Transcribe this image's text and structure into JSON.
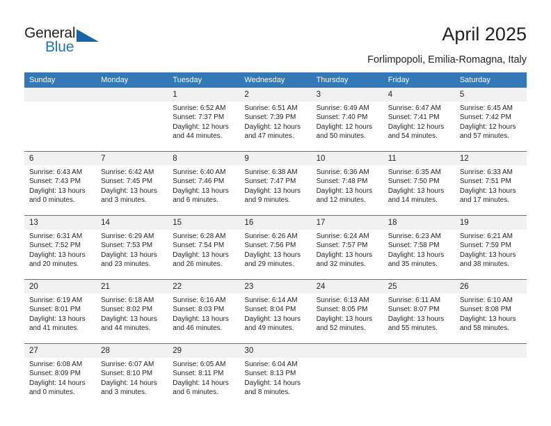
{
  "brand": {
    "name_part1": "General",
    "name_part2": "Blue",
    "accent_color": "#1b76bf"
  },
  "header": {
    "title": "April 2025",
    "subtitle": "Forlimpopoli, Emilia-Romagna, Italy"
  },
  "calendar": {
    "header_bg": "#3479b7",
    "daynum_bg": "#f1f1f1",
    "weekday_headers": [
      "Sunday",
      "Monday",
      "Tuesday",
      "Wednesday",
      "Thursday",
      "Friday",
      "Saturday"
    ],
    "weeks": [
      [
        {
          "day": "",
          "lines": []
        },
        {
          "day": "",
          "lines": []
        },
        {
          "day": "1",
          "lines": [
            "Sunrise: 6:52 AM",
            "Sunset: 7:37 PM",
            "Daylight: 12 hours",
            "and 44 minutes."
          ]
        },
        {
          "day": "2",
          "lines": [
            "Sunrise: 6:51 AM",
            "Sunset: 7:39 PM",
            "Daylight: 12 hours",
            "and 47 minutes."
          ]
        },
        {
          "day": "3",
          "lines": [
            "Sunrise: 6:49 AM",
            "Sunset: 7:40 PM",
            "Daylight: 12 hours",
            "and 50 minutes."
          ]
        },
        {
          "day": "4",
          "lines": [
            "Sunrise: 6:47 AM",
            "Sunset: 7:41 PM",
            "Daylight: 12 hours",
            "and 54 minutes."
          ]
        },
        {
          "day": "5",
          "lines": [
            "Sunrise: 6:45 AM",
            "Sunset: 7:42 PM",
            "Daylight: 12 hours",
            "and 57 minutes."
          ]
        }
      ],
      [
        {
          "day": "6",
          "lines": [
            "Sunrise: 6:43 AM",
            "Sunset: 7:43 PM",
            "Daylight: 13 hours",
            "and 0 minutes."
          ]
        },
        {
          "day": "7",
          "lines": [
            "Sunrise: 6:42 AM",
            "Sunset: 7:45 PM",
            "Daylight: 13 hours",
            "and 3 minutes."
          ]
        },
        {
          "day": "8",
          "lines": [
            "Sunrise: 6:40 AM",
            "Sunset: 7:46 PM",
            "Daylight: 13 hours",
            "and 6 minutes."
          ]
        },
        {
          "day": "9",
          "lines": [
            "Sunrise: 6:38 AM",
            "Sunset: 7:47 PM",
            "Daylight: 13 hours",
            "and 9 minutes."
          ]
        },
        {
          "day": "10",
          "lines": [
            "Sunrise: 6:36 AM",
            "Sunset: 7:48 PM",
            "Daylight: 13 hours",
            "and 12 minutes."
          ]
        },
        {
          "day": "11",
          "lines": [
            "Sunrise: 6:35 AM",
            "Sunset: 7:50 PM",
            "Daylight: 13 hours",
            "and 14 minutes."
          ]
        },
        {
          "day": "12",
          "lines": [
            "Sunrise: 6:33 AM",
            "Sunset: 7:51 PM",
            "Daylight: 13 hours",
            "and 17 minutes."
          ]
        }
      ],
      [
        {
          "day": "13",
          "lines": [
            "Sunrise: 6:31 AM",
            "Sunset: 7:52 PM",
            "Daylight: 13 hours",
            "and 20 minutes."
          ]
        },
        {
          "day": "14",
          "lines": [
            "Sunrise: 6:29 AM",
            "Sunset: 7:53 PM",
            "Daylight: 13 hours",
            "and 23 minutes."
          ]
        },
        {
          "day": "15",
          "lines": [
            "Sunrise: 6:28 AM",
            "Sunset: 7:54 PM",
            "Daylight: 13 hours",
            "and 26 minutes."
          ]
        },
        {
          "day": "16",
          "lines": [
            "Sunrise: 6:26 AM",
            "Sunset: 7:56 PM",
            "Daylight: 13 hours",
            "and 29 minutes."
          ]
        },
        {
          "day": "17",
          "lines": [
            "Sunrise: 6:24 AM",
            "Sunset: 7:57 PM",
            "Daylight: 13 hours",
            "and 32 minutes."
          ]
        },
        {
          "day": "18",
          "lines": [
            "Sunrise: 6:23 AM",
            "Sunset: 7:58 PM",
            "Daylight: 13 hours",
            "and 35 minutes."
          ]
        },
        {
          "day": "19",
          "lines": [
            "Sunrise: 6:21 AM",
            "Sunset: 7:59 PM",
            "Daylight: 13 hours",
            "and 38 minutes."
          ]
        }
      ],
      [
        {
          "day": "20",
          "lines": [
            "Sunrise: 6:19 AM",
            "Sunset: 8:01 PM",
            "Daylight: 13 hours",
            "and 41 minutes."
          ]
        },
        {
          "day": "21",
          "lines": [
            "Sunrise: 6:18 AM",
            "Sunset: 8:02 PM",
            "Daylight: 13 hours",
            "and 44 minutes."
          ]
        },
        {
          "day": "22",
          "lines": [
            "Sunrise: 6:16 AM",
            "Sunset: 8:03 PM",
            "Daylight: 13 hours",
            "and 46 minutes."
          ]
        },
        {
          "day": "23",
          "lines": [
            "Sunrise: 6:14 AM",
            "Sunset: 8:04 PM",
            "Daylight: 13 hours",
            "and 49 minutes."
          ]
        },
        {
          "day": "24",
          "lines": [
            "Sunrise: 6:13 AM",
            "Sunset: 8:05 PM",
            "Daylight: 13 hours",
            "and 52 minutes."
          ]
        },
        {
          "day": "25",
          "lines": [
            "Sunrise: 6:11 AM",
            "Sunset: 8:07 PM",
            "Daylight: 13 hours",
            "and 55 minutes."
          ]
        },
        {
          "day": "26",
          "lines": [
            "Sunrise: 6:10 AM",
            "Sunset: 8:08 PM",
            "Daylight: 13 hours",
            "and 58 minutes."
          ]
        }
      ],
      [
        {
          "day": "27",
          "lines": [
            "Sunrise: 6:08 AM",
            "Sunset: 8:09 PM",
            "Daylight: 14 hours",
            "and 0 minutes."
          ]
        },
        {
          "day": "28",
          "lines": [
            "Sunrise: 6:07 AM",
            "Sunset: 8:10 PM",
            "Daylight: 14 hours",
            "and 3 minutes."
          ]
        },
        {
          "day": "29",
          "lines": [
            "Sunrise: 6:05 AM",
            "Sunset: 8:11 PM",
            "Daylight: 14 hours",
            "and 6 minutes."
          ]
        },
        {
          "day": "30",
          "lines": [
            "Sunrise: 6:04 AM",
            "Sunset: 8:13 PM",
            "Daylight: 14 hours",
            "and 8 minutes."
          ]
        },
        {
          "day": "",
          "lines": []
        },
        {
          "day": "",
          "lines": []
        },
        {
          "day": "",
          "lines": []
        }
      ]
    ]
  }
}
